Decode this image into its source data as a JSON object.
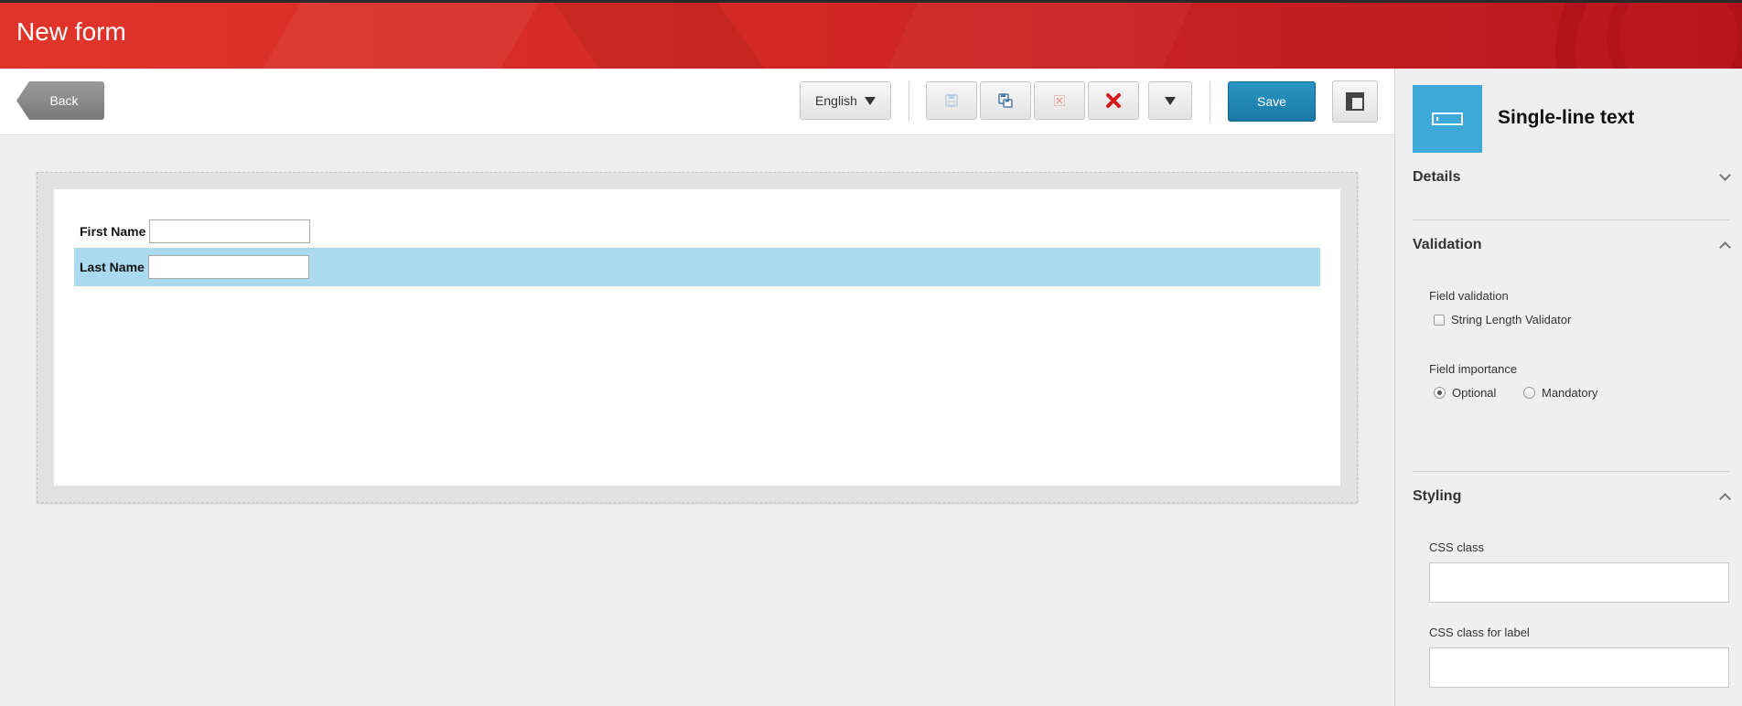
{
  "header": {
    "title": "New form"
  },
  "toolbar": {
    "back_label": "Back",
    "language": "English",
    "save_label": "Save"
  },
  "form": {
    "fields": [
      {
        "label": "First Name",
        "value": "",
        "selected": false
      },
      {
        "label": "Last Name",
        "value": "",
        "selected": true
      }
    ]
  },
  "panel": {
    "title": "Single-line text",
    "sections": {
      "details": "Details",
      "validation": "Validation",
      "styling": "Styling"
    },
    "validation": {
      "field_validation_label": "Field validation",
      "validator_option": "String Length Validator",
      "field_importance_label": "Field importance",
      "optional": "Optional",
      "mandatory": "Mandatory",
      "selected_importance": "Optional"
    },
    "styling": {
      "css_class_label": "CSS class",
      "css_class_value": "",
      "css_label_class_label": "CSS class for label",
      "css_label_class_value": ""
    }
  },
  "colors": {
    "header_red": "#d42a25",
    "accent_blue": "#1a7aa8",
    "selected_row": "#a9daee",
    "field_icon_bg": "#3ea9d9"
  }
}
